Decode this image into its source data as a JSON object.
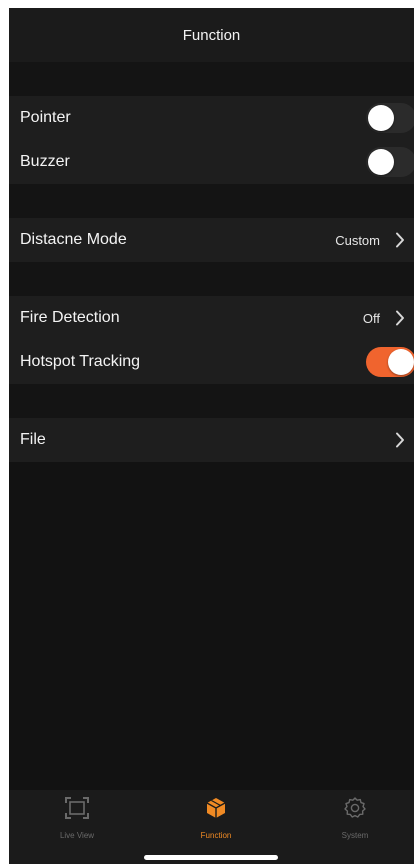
{
  "header": {
    "title": "Function"
  },
  "groups": {
    "general": {
      "pointer": {
        "label": "Pointer",
        "enabled": false
      },
      "buzzer": {
        "label": "Buzzer",
        "enabled": false
      }
    },
    "distance": {
      "label": "Distacne Mode",
      "value": "Custom"
    },
    "detection": {
      "fire": {
        "label": "Fire Detection",
        "value": "Off"
      },
      "hotspot": {
        "label": "Hotspot Tracking",
        "enabled": true
      }
    },
    "file": {
      "label": "File"
    }
  },
  "tabbar": {
    "live_view": {
      "label": "Live View",
      "icon": "frame-icon"
    },
    "function": {
      "label": "Function",
      "icon": "box-icon",
      "active": true
    },
    "system": {
      "label": "System",
      "icon": "gear-icon"
    }
  },
  "colors": {
    "accent": "#f08a24",
    "toggle_on": "#f0642e",
    "background": "#121212"
  }
}
